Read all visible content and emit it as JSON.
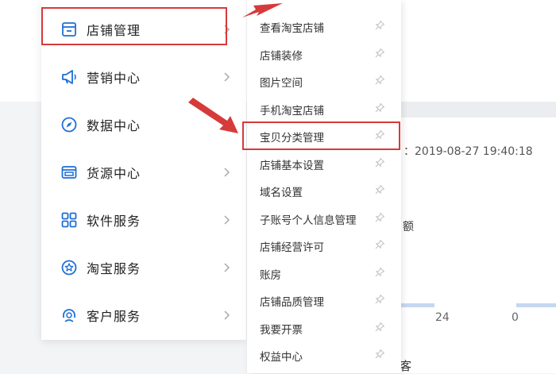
{
  "menu": {
    "items": [
      {
        "label": "店铺管理",
        "icon": "store-icon"
      },
      {
        "label": "营销中心",
        "icon": "megaphone-icon"
      },
      {
        "label": "数据中心",
        "icon": "compass-icon"
      },
      {
        "label": "货源中心",
        "icon": "window-icon"
      },
      {
        "label": "软件服务",
        "icon": "grid-icon"
      },
      {
        "label": "淘宝服务",
        "icon": "star-badge-icon"
      },
      {
        "label": "客户服务",
        "icon": "headset-icon"
      }
    ]
  },
  "submenu": {
    "items": [
      {
        "label": "查看淘宝店铺"
      },
      {
        "label": "店铺装修"
      },
      {
        "label": "图片空间"
      },
      {
        "label": "手机淘宝店铺"
      },
      {
        "label": "宝贝分类管理"
      },
      {
        "label": "店铺基本设置"
      },
      {
        "label": "域名设置"
      },
      {
        "label": "子账号个人信息管理"
      },
      {
        "label": "店铺经营许可"
      },
      {
        "label": "账房"
      },
      {
        "label": "店铺品质管理"
      },
      {
        "label": "我要开票"
      },
      {
        "label": "权益中心"
      }
    ]
  },
  "background": {
    "timestamp": "：2019-08-27 19:40:18",
    "fragment": "额",
    "num_a": "24",
    "num_b": "0",
    "bottom_fragment": "客"
  },
  "colors": {
    "highlight": "#d63a3a",
    "icon_blue": "#1e6fd6"
  }
}
